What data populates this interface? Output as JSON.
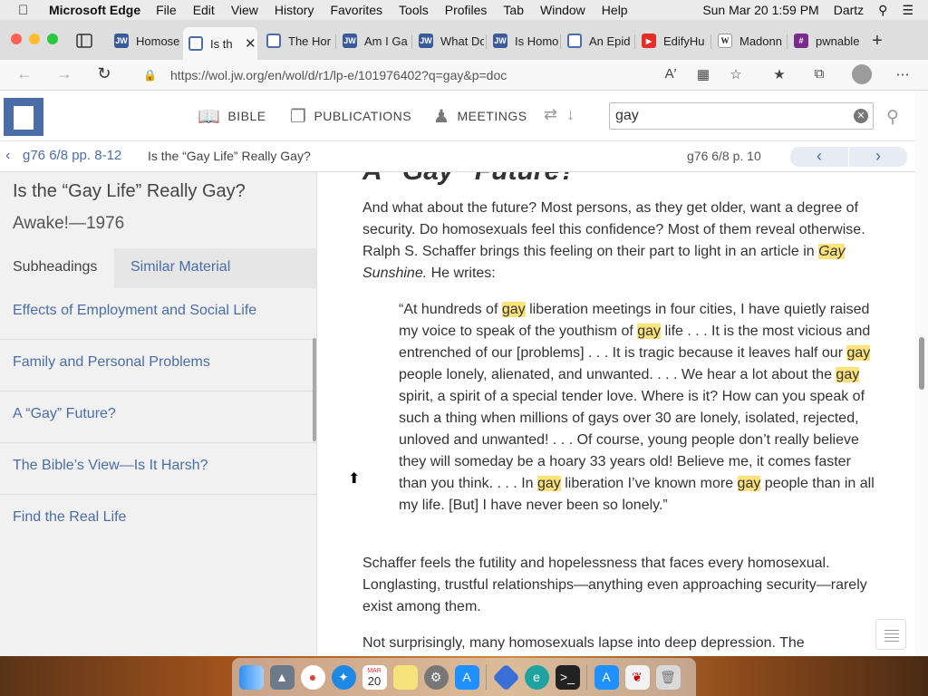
{
  "menubar": {
    "app_name": "Microsoft Edge",
    "items": [
      "File",
      "Edit",
      "View",
      "History",
      "Favorites",
      "Tools",
      "Profiles",
      "Tab",
      "Window",
      "Help"
    ],
    "clock": "Sun Mar 20  1:59 PM",
    "user": "Dartz"
  },
  "tabs": [
    {
      "title": "Homose",
      "icon": "jw-icon",
      "color": "#3a5a9a",
      "glyph": "JW"
    },
    {
      "title": "Is th",
      "icon": "wol-page-icon",
      "color": "#4a6da7",
      "glyph": "",
      "active": true
    },
    {
      "title": "The Hor",
      "icon": "wol-page-icon",
      "color": "#4a6da7",
      "glyph": ""
    },
    {
      "title": "Am I Ga",
      "icon": "jw-icon",
      "color": "#3a5a9a",
      "glyph": "JW"
    },
    {
      "title": "What Do",
      "icon": "jw-icon",
      "color": "#3a5a9a",
      "glyph": "JW"
    },
    {
      "title": "Is Homo",
      "icon": "jw-icon",
      "color": "#3a5a9a",
      "glyph": "JW"
    },
    {
      "title": "An Epid",
      "icon": "wol-page-icon",
      "color": "#4a6da7",
      "glyph": ""
    },
    {
      "title": "EdifyHu",
      "icon": "youtube-icon",
      "color": "#e52d27",
      "glyph": "▶"
    },
    {
      "title": "Madonn",
      "icon": "wikipedia-icon",
      "color": "#ffffff",
      "glyph": "W"
    },
    {
      "title": "pwnable",
      "icon": "hash-icon",
      "color": "#7a2a8a",
      "glyph": "#"
    }
  ],
  "address": {
    "url": "https://wol.jw.org/en/wol/d/r1/lp-e/101976402?q=gay&p=doc"
  },
  "site_nav": {
    "bible": "BIBLE",
    "publications": "PUBLICATIONS",
    "meetings": "MEETINGS",
    "search_value": "gay"
  },
  "breadcrumb": {
    "ref": "g76 6/8 pp. 8-12",
    "title": "Is the “Gay Life” Really Gay?",
    "page": "g76 6/8 p. 10"
  },
  "sidebar": {
    "title": "Is the “Gay Life” Really Gay?",
    "subtitle": "Awake!—1976",
    "tab1": "Subheadings",
    "tab2": "Similar Material",
    "items": [
      "Effects of Employment and Social Life",
      "Family and Personal Problems",
      "A “Gay” Future?",
      "The Bible’s View—Is It Harsh?",
      "Find the Real Life"
    ]
  },
  "article": {
    "heading": "A “Gay” Future?",
    "p1_a": "And what about the future? Most persons, as they get older, want a degree of security. Do homosexuals feel this confidence? Most of them reveal otherwise. Ralph S. Schaffer brings this feeling on their part to light in an article in ",
    "p1_hl": "Gay",
    "p1_it": " Sunshine.",
    "p1_b": " He writes:",
    "q": [
      "“At hundreds of ",
      "gay",
      " liberation meetings in four cities, I have quietly raised my voice to speak of the youthism of ",
      "gay",
      " life . . . It is the most vicious and entrenched of our [problems] . . . It is tragic because it leaves half our ",
      "gay",
      " people lonely, alienated, and unwanted. . . . We hear a lot about the ",
      "gay",
      " spirit, a spirit of a special tender love. Where is it? How can you speak of such a thing when millions of gays over 30 are lonely, isolated, rejected, unloved and unwanted! . . . Of course, young people don’t really believe they will someday be a hoary 33 years old! Believe me, it comes faster than you think. . . . In ",
      "gay",
      " liberation I’ve known more ",
      "gay",
      " people than in all my life. [But] I have never been so lonely.”"
    ],
    "p2": "Schaffer feels the futility and hopelessness that faces every homosexual. Longlasting, trustful relationships—anything even approaching security—rarely exist among them.",
    "p3": "Not surprisingly, many homosexuals lapse into deep depression. The"
  },
  "dock": {
    "calendar_month": "MAR",
    "calendar_day": "20"
  },
  "colors": {
    "accent": "#4a6da7",
    "highlight": "#fbe27a"
  }
}
